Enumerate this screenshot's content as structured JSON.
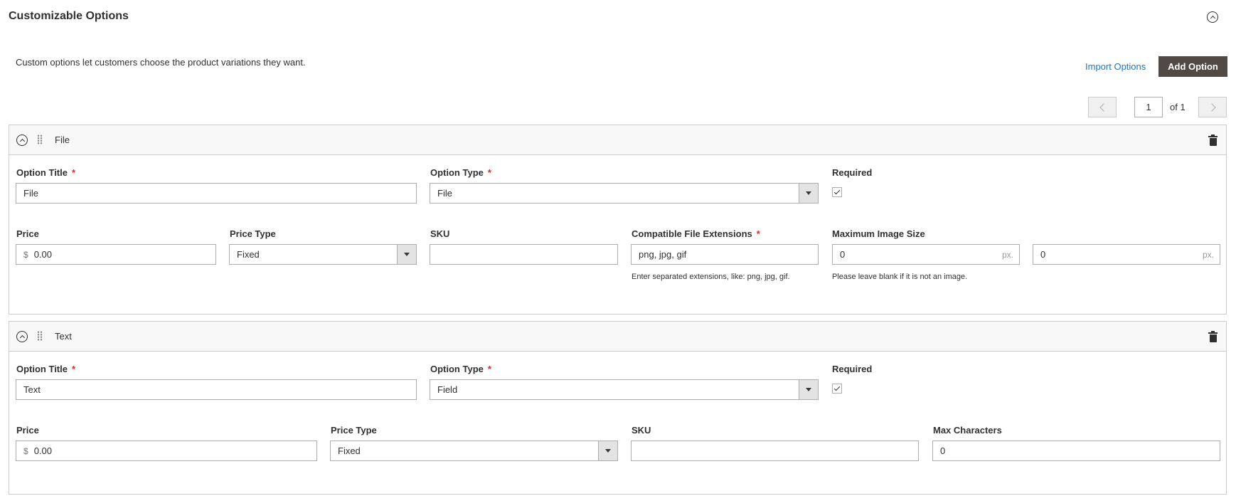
{
  "section": {
    "title": "Customizable Options",
    "intro": "Custom options let customers choose the product variations they want.",
    "import_label": "Import Options",
    "add_label": "Add Option"
  },
  "pager": {
    "current": "1",
    "of_label": "of 1"
  },
  "options": [
    {
      "name": "File",
      "labels": {
        "title": "Option Title",
        "type": "Option Type",
        "required": "Required",
        "price": "Price",
        "price_type": "Price Type",
        "sku": "SKU",
        "extensions": "Compatible File Extensions",
        "max_image": "Maximum Image Size"
      },
      "title_value": "File",
      "type_value": "File",
      "required": true,
      "currency": "$",
      "price_value": "0.00",
      "price_type_value": "Fixed",
      "sku_value": "",
      "extensions_value": "png, jpg, gif",
      "extensions_note": "Enter separated extensions, like: png, jpg, gif.",
      "width_value": "0",
      "height_value": "0",
      "px_suffix": "px.",
      "image_note": "Please leave blank if it is not an image."
    },
    {
      "name": "Text",
      "labels": {
        "title": "Option Title",
        "type": "Option Type",
        "required": "Required",
        "price": "Price",
        "price_type": "Price Type",
        "sku": "SKU",
        "max_chars": "Max Characters"
      },
      "title_value": "Text",
      "type_value": "Field",
      "required": true,
      "currency": "$",
      "price_value": "0.00",
      "price_type_value": "Fixed",
      "sku_value": "",
      "max_chars_value": "0"
    }
  ],
  "icons": {
    "collapse": "chevron-up-circle-icon",
    "drag": "drag-handle-icon",
    "delete": "trash-icon",
    "prev": "chevron-left-icon",
    "next": "chevron-right-icon",
    "dropdown": "triangle-down-icon",
    "check": "checkmark-icon"
  },
  "colors": {
    "primary_button": "#514943",
    "link": "#1979c3",
    "required_star": "#e22626",
    "header_bg": "#f8f8f8"
  }
}
